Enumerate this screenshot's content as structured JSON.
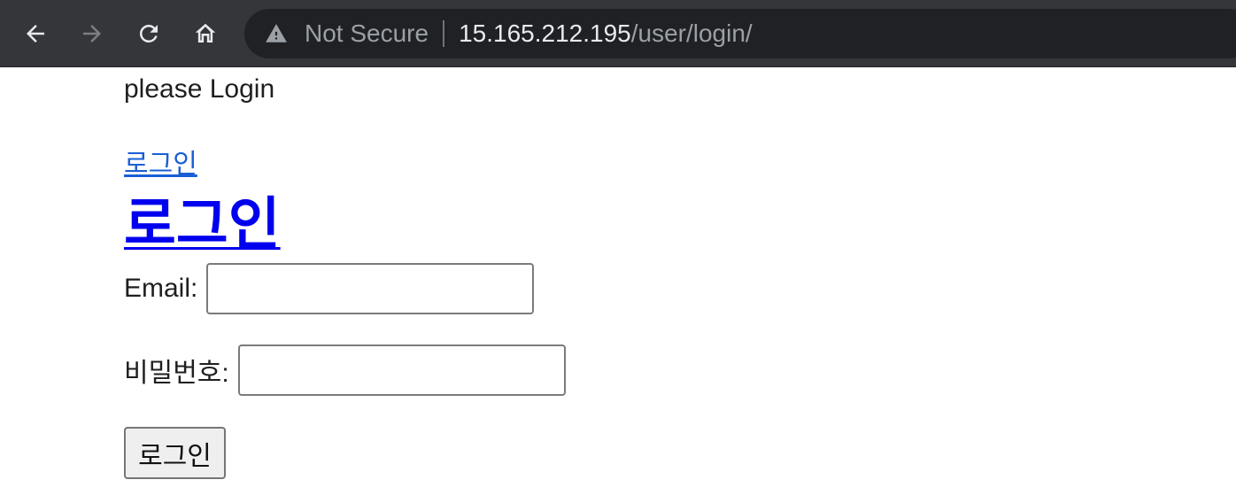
{
  "browser": {
    "nav": {
      "back_icon": "arrow-left-icon",
      "forward_icon": "arrow-right-icon",
      "reload_icon": "reload-icon",
      "home_icon": "home-icon"
    },
    "omnibox": {
      "security_icon": "warning-triangle-icon",
      "security_text": "Not Secure",
      "url_host": "15.165.212.195",
      "url_path": "/user/login/"
    }
  },
  "page": {
    "greeting": "please Login",
    "login_link": "로그인",
    "title": "로그인",
    "form": {
      "email_label": "Email:",
      "email_value": "",
      "password_label": "비밀번호:",
      "password_value": "",
      "submit_label": "로그인"
    }
  },
  "colors": {
    "toolbar_bg": "#35363a",
    "omnibox_bg": "#202124",
    "link_blue": "#1a5fd6",
    "title_blue": "#0000ee"
  }
}
